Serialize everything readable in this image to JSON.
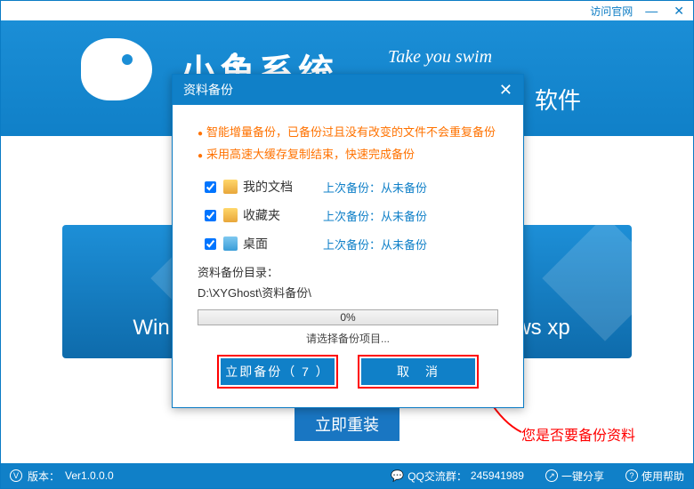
{
  "titlebar": {
    "official_site": "访问官网"
  },
  "header": {
    "brand": "小鱼系统",
    "slogan": "Take you swim",
    "sub": "软件"
  },
  "tiles": {
    "left": "Win",
    "right": "ws xp"
  },
  "reinstall_button": "立即重装",
  "dialog": {
    "title": "资料备份",
    "bullet1": "智能增量备份，已备份过且没有改变的文件不会重复备份",
    "bullet2": "采用高速大缓存复制结束，快速完成备份",
    "items": [
      {
        "label": "我的文档",
        "last": "上次备份：从未备份"
      },
      {
        "label": "收藏夹",
        "last": "上次备份：从未备份"
      },
      {
        "label": "桌面",
        "last": "上次备份：从未备份"
      }
    ],
    "path_label": "资料备份目录：",
    "path": "D:\\XYGhost\\资料备份\\",
    "progress": "0%",
    "hint": "请选择备份项目...",
    "backup_btn": "立即备份（ 7 ）",
    "cancel_btn": "取　消"
  },
  "annotation": "您是否要备份资料",
  "statusbar": {
    "version_label": "版本：",
    "version": "Ver1.0.0.0",
    "qq_label": "QQ交流群：",
    "qq": "245941989",
    "share": "一键分享",
    "help": "使用帮助"
  }
}
